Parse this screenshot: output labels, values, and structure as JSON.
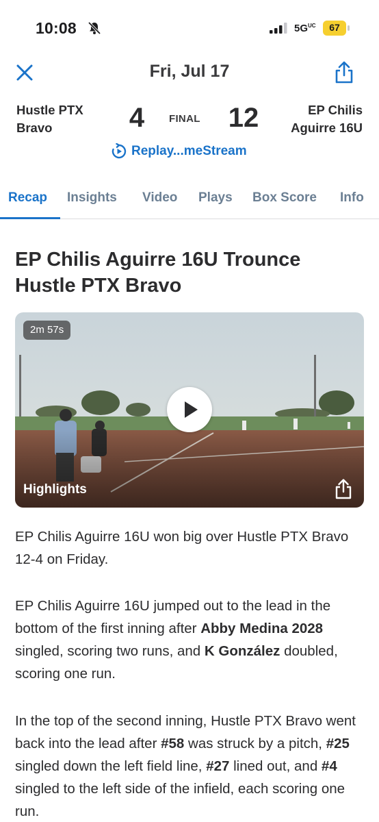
{
  "status_bar": {
    "time": "10:08",
    "network": "5G",
    "network_sup": "UC",
    "battery": "67",
    "battery_color": "#f6cf2f"
  },
  "header": {
    "date": "Fri, Jul 17",
    "close_icon": "close-icon",
    "share_icon": "share-icon"
  },
  "game": {
    "away_team_line1": "Hustle PTX",
    "away_team_line2": "Bravo",
    "away_score": "4",
    "status": "FINAL",
    "home_score": "12",
    "home_team_line1": "EP Chilis",
    "home_team_line2": "Aguirre 16U",
    "replay_label": "Replay...meStream"
  },
  "tabs": [
    {
      "label": "Recap",
      "active": true
    },
    {
      "label": "Insights",
      "active": false
    },
    {
      "label": "Video",
      "active": false
    },
    {
      "label": "Plays",
      "active": false
    },
    {
      "label": "Box Score",
      "active": false
    },
    {
      "label": "Info",
      "active": false
    }
  ],
  "article": {
    "headline": "EP Chilis Aguirre 16U Trounce Hustle PTX Bravo",
    "video": {
      "duration": "2m 57s",
      "title": "Highlights"
    },
    "p1": "EP Chilis Aguirre 16U won big over Hustle PTX Bravo  12-4 on Friday.",
    "p2": {
      "t1": "EP Chilis Aguirre 16U jumped out to the lead in the bottom of the first inning after ",
      "b1": "Abby Medina 2028",
      "t2": " singled, scoring two runs, and ",
      "b2": "K González",
      "t3": " doubled, scoring one run."
    },
    "p3": {
      "t1": "In the top of the second inning, Hustle PTX Bravo  went back into the lead after ",
      "b1": "#58",
      "t2": " was struck by a pitch, ",
      "b2": "#25",
      "t3": " singled down the left field line, ",
      "b3": "#27",
      "t4": " lined out, and ",
      "b4": "#4",
      "t5": " singled to the left side of the infield, each scoring one run."
    }
  },
  "colors": {
    "accent": "#1a73c9",
    "tab_inactive": "#6b7f93"
  }
}
